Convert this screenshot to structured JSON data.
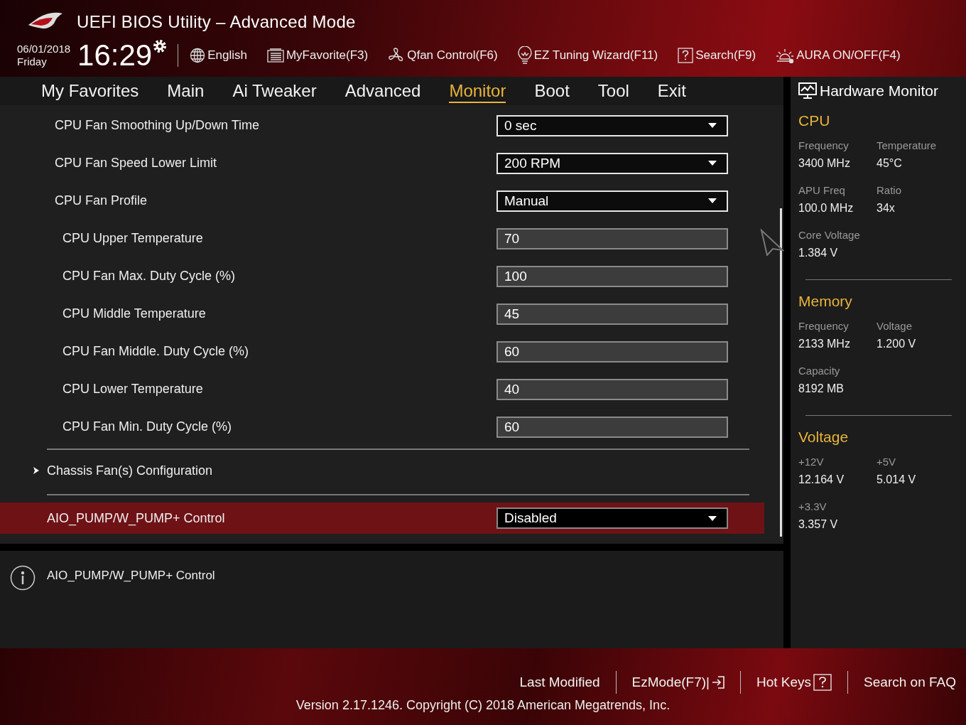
{
  "window": {
    "title": "UEFI BIOS Utility – Advanced Mode"
  },
  "clock": {
    "date": "06/01/2018",
    "day": "Friday",
    "time": "16:29"
  },
  "toolbar": [
    {
      "kind": "globe",
      "label": "English"
    },
    {
      "kind": "favorite",
      "label": "MyFavorite(F3)"
    },
    {
      "kind": "fan",
      "label": "Qfan Control(F6)"
    },
    {
      "kind": "bulb",
      "label": "EZ Tuning Wizard(F11)"
    },
    {
      "kind": "question",
      "label": "Search(F9)"
    },
    {
      "kind": "aura",
      "label": "AURA ON/OFF(F4)"
    }
  ],
  "tabs": [
    {
      "label": "My Favorites",
      "selected": false
    },
    {
      "label": "Main",
      "selected": false
    },
    {
      "label": "Ai Tweaker",
      "selected": false
    },
    {
      "label": "Advanced",
      "selected": false
    },
    {
      "label": "Monitor",
      "selected": true
    },
    {
      "label": "Boot",
      "selected": false
    },
    {
      "label": "Tool",
      "selected": false
    },
    {
      "label": "Exit",
      "selected": false
    }
  ],
  "fan_settings": [
    {
      "kind": "dropdown",
      "label": "CPU Fan Smoothing Up/Down Time",
      "value": "0 sec",
      "selected": false
    },
    {
      "kind": "dropdown",
      "label": "CPU Fan Speed Lower Limit",
      "value": "200 RPM",
      "selected": false
    },
    {
      "kind": "dropdown",
      "label": "CPU Fan Profile",
      "value": "Manual",
      "selected": false,
      "children": [
        {
          "kind": "input",
          "label": "CPU Upper Temperature",
          "value": "70",
          "selected": false
        },
        {
          "kind": "input",
          "label": "CPU Fan Max. Duty Cycle (%)",
          "value": "100",
          "selected": false
        },
        {
          "kind": "input",
          "label": "CPU Middle Temperature",
          "value": "45",
          "selected": false
        },
        {
          "kind": "input",
          "label": "CPU Fan Middle. Duty Cycle (%)",
          "value": "60",
          "selected": false
        },
        {
          "kind": "input",
          "label": "CPU Lower Temperature",
          "value": "40",
          "selected": false
        },
        {
          "kind": "input",
          "label": "CPU Fan Min. Duty Cycle (%)",
          "value": "60",
          "selected": false
        }
      ]
    }
  ],
  "submenu": {
    "label": "Chassis Fan(s) Configuration"
  },
  "pump_setting": {
    "kind": "dropdown",
    "label": "AIO_PUMP/W_PUMP+ Control",
    "value": "Disabled",
    "selected": true
  },
  "help": {
    "text": "AIO_PUMP/W_PUMP+ Control"
  },
  "hardware_monitor": {
    "title": "Hardware Monitor",
    "sections": [
      {
        "title": "CPU",
        "readings": [
          {
            "label": "Frequency",
            "value": "3400 MHz"
          },
          {
            "label": "Temperature",
            "value": "45°C"
          },
          {
            "label": "APU Freq",
            "value": "100.0 MHz"
          },
          {
            "label": "Ratio",
            "value": "34x"
          },
          {
            "label": "Core Voltage",
            "value": "1.384 V"
          }
        ]
      },
      {
        "title": "Memory",
        "readings": [
          {
            "label": "Frequency",
            "value": "2133 MHz"
          },
          {
            "label": "Voltage",
            "value": "1.200 V"
          },
          {
            "label": "Capacity",
            "value": "8192 MB"
          }
        ]
      },
      {
        "title": "Voltage",
        "readings": [
          {
            "label": "+12V",
            "value": "12.164 V"
          },
          {
            "label": "+5V",
            "value": "5.014 V"
          },
          {
            "label": "+3.3V",
            "value": "3.357 V"
          }
        ]
      }
    ]
  },
  "footer": {
    "links": [
      {
        "kind": "plain",
        "label": "Last Modified"
      },
      {
        "kind": "exit",
        "label": "EzMode(F7)|"
      },
      {
        "kind": "help",
        "label": "Hot Keys"
      },
      {
        "kind": "plain",
        "label": "Search on FAQ"
      }
    ],
    "version": "Version 2.17.1246. Copyright (C) 2018 American Megatrends, Inc."
  }
}
